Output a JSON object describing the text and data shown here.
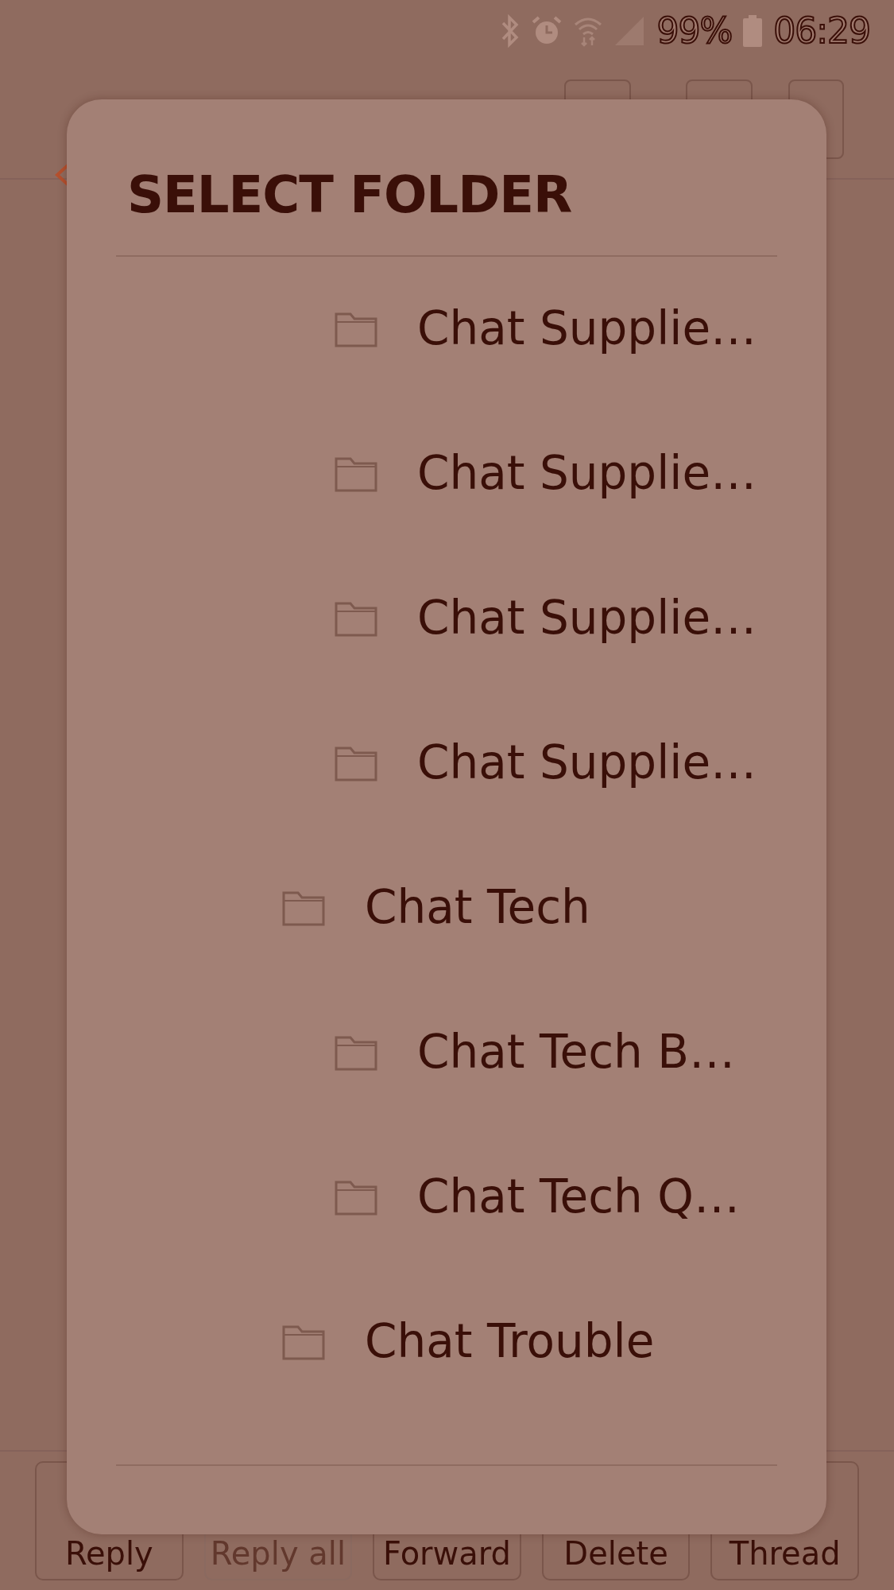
{
  "status_bar": {
    "battery_text": "99%",
    "time": "06:29"
  },
  "dialog": {
    "title": "SELECT FOLDER",
    "folders": [
      {
        "children": [
          {
            "label": "Chat Supplie…"
          },
          {
            "label": "Chat Supplie…"
          },
          {
            "label": "Chat Supplie…"
          },
          {
            "label": "Chat Supplie…"
          }
        ]
      },
      {
        "label": "Chat Tech",
        "children": [
          {
            "label": "Chat Tech B…"
          },
          {
            "label": "Chat Tech Q…"
          }
        ]
      },
      {
        "label": "Chat Trouble"
      }
    ]
  },
  "bottom_buttons": [
    {
      "label": "Reply",
      "disabled": false
    },
    {
      "label": "Reply all",
      "disabled": true
    },
    {
      "label": "Forward",
      "disabled": false
    },
    {
      "label": "Delete",
      "disabled": false
    },
    {
      "label": "Thread",
      "disabled": false
    }
  ]
}
